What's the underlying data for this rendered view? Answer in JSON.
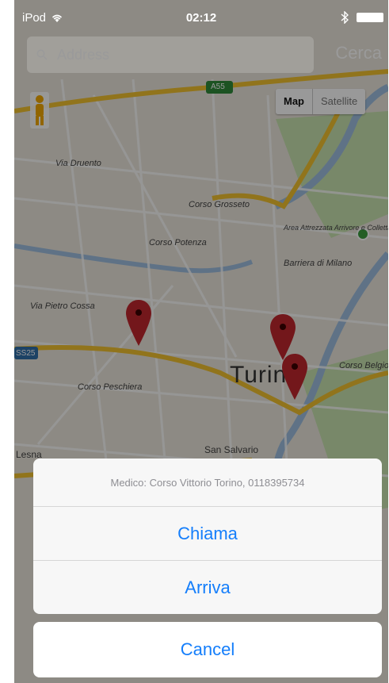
{
  "status_bar": {
    "carrier": "iPod",
    "time": "02:12",
    "wifi_icon": "wifi-icon",
    "bluetooth_icon": "bluetooth-icon",
    "battery_icon": "battery-icon"
  },
  "search": {
    "placeholder": "Address",
    "button_label": "Cerca",
    "icon": "search-icon"
  },
  "map": {
    "type_toggle": {
      "map_label": "Map",
      "satellite_label": "Satellite"
    },
    "city_label": "Turin",
    "street_labels": {
      "via_druento": "Via Druento",
      "corso_grosseto": "Corso Grosseto",
      "aree": "Area Attrezzata Arrivore e Colletta",
      "barriera": "Barriera di Milano",
      "corso_potenza": "Corso Potenza",
      "via_pietro_cossa": "Via Pietro Cossa",
      "corso_peschiera": "Corso Peschiera",
      "corso_belgio": "Corso Belgio",
      "ss25": "SS25",
      "a55": "A55",
      "san_salvario": "San Salvario",
      "lesna": "Lesna"
    },
    "pins": [
      "map-pin-1",
      "map-pin-2",
      "map-pin-3"
    ]
  },
  "action_sheet": {
    "title": "Medico: Corso Vittorio Torino, 0118395734",
    "call_label": "Chiama",
    "directions_label": "Arriva",
    "cancel_label": "Cancel"
  },
  "colors": {
    "ios_blue": "#147efb",
    "pin_red": "#c0272d",
    "road_yellow": "#f2c230",
    "water_blue": "#8fb3d9",
    "park_green": "#bfe0a5"
  }
}
